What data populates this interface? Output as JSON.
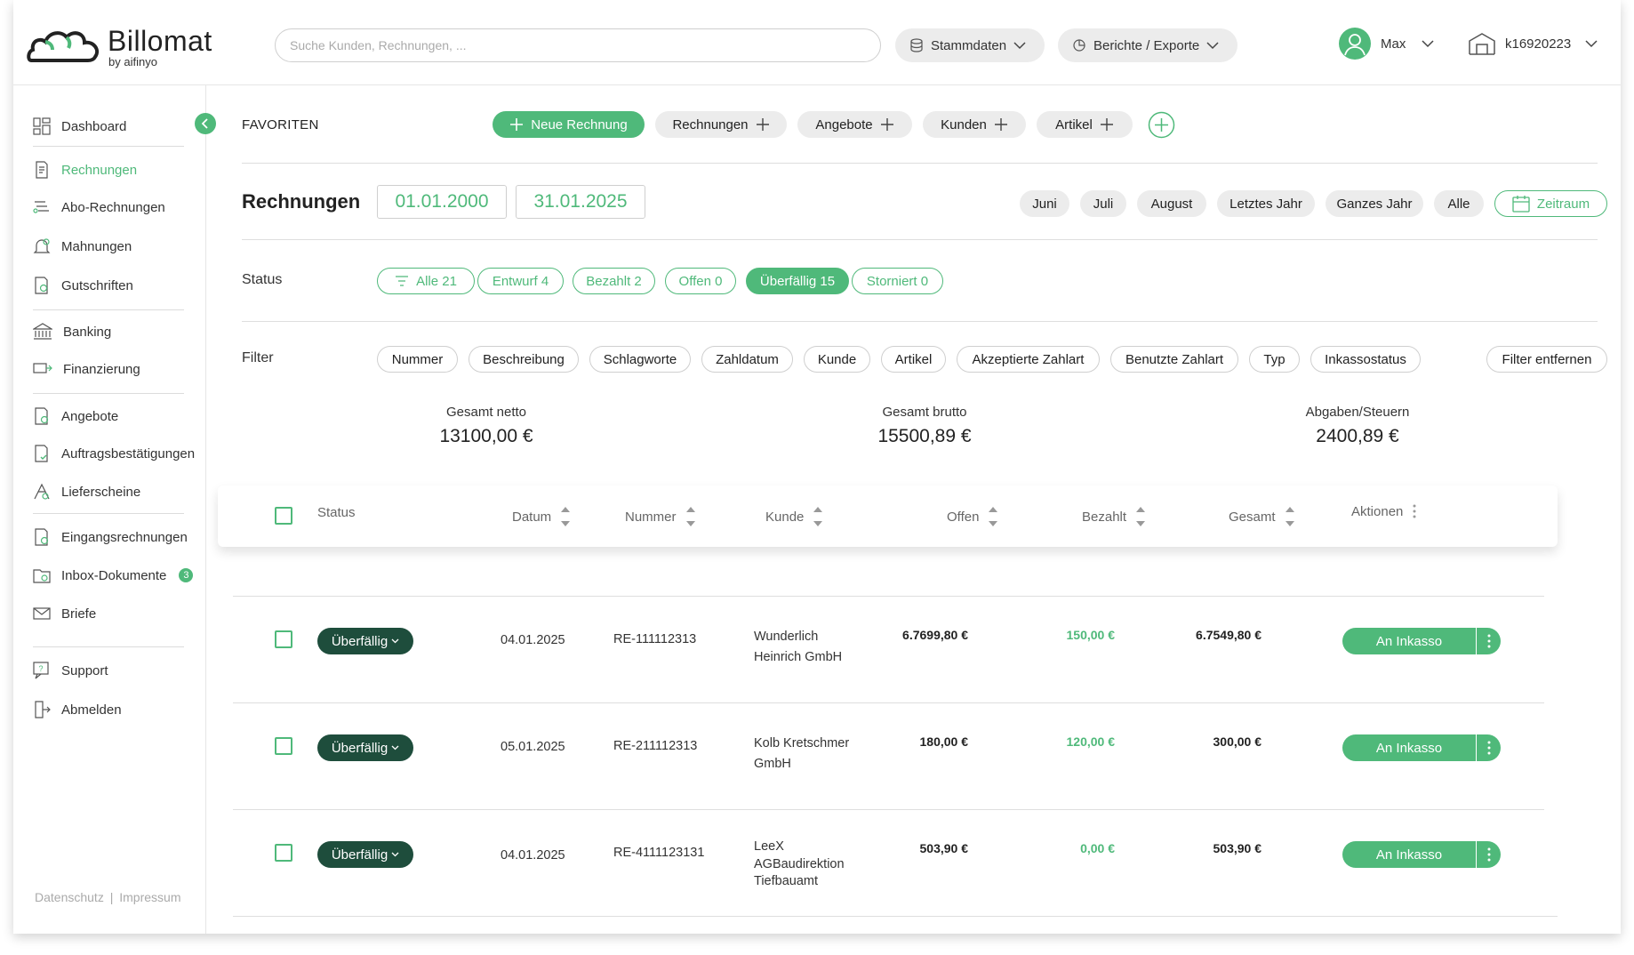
{
  "header": {
    "logo": {
      "brand": "Billomat",
      "sub": "by aifinyo"
    },
    "search": {
      "placeholder": "Suche Kunden, Rechnungen, ..."
    },
    "menus": [
      {
        "label": "Stammdaten",
        "icon": "database-icon"
      },
      {
        "label": "Berichte / Exporte",
        "icon": "pie-chart-icon"
      }
    ],
    "user": {
      "name": "Max",
      "icon": "user-avatar-icon"
    },
    "account": {
      "id": "k16920223",
      "icon": "building-icon"
    }
  },
  "sidebar": {
    "items": [
      {
        "label": "Dashboard",
        "icon": "dashboard-icon"
      },
      {
        "label": "Rechnungen",
        "icon": "invoice-icon",
        "active": true
      },
      {
        "label": "Abo-Rechnungen",
        "icon": "recurring-invoice-icon"
      },
      {
        "label": "Mahnungen",
        "icon": "reminder-icon"
      },
      {
        "label": "Gutschriften",
        "icon": "credit-note-icon"
      },
      {
        "label": "Banking",
        "icon": "bank-icon"
      },
      {
        "label": "Finanzierung",
        "icon": "financing-icon"
      },
      {
        "label": "Angebote",
        "icon": "offer-icon"
      },
      {
        "label": "Auftragsbestätigungen",
        "icon": "order-confirmation-icon"
      },
      {
        "label": "Lieferscheine",
        "icon": "delivery-note-icon"
      },
      {
        "label": "Eingangsrechnungen",
        "icon": "incoming-invoice-icon"
      },
      {
        "label": "Inbox-Dokumente",
        "icon": "inbox-icon",
        "badge": "3"
      },
      {
        "label": "Briefe",
        "icon": "letter-icon"
      },
      {
        "label": "Support",
        "icon": "support-icon"
      },
      {
        "label": "Abmelden",
        "icon": "logout-icon"
      }
    ],
    "footer": {
      "privacy": "Datenschutz",
      "separator": "|",
      "imprint": "Impressum"
    }
  },
  "favorites": {
    "label": "FAVORITEN",
    "new_invoice": "Neue Rechnung",
    "items": [
      "Rechnungen",
      "Angebote",
      "Kunden",
      "Artikel"
    ]
  },
  "page": {
    "title": "Rechnungen",
    "date_from": "01.01.2000",
    "date_to": "31.01.2025",
    "quick_ranges": [
      "Juni",
      "Juli",
      "August",
      "Letztes Jahr",
      "Ganzes Jahr",
      "Alle"
    ],
    "period_button": "Zeitraum"
  },
  "status": {
    "label": "Status",
    "filters": [
      {
        "label": "Alle 21",
        "selected": false
      },
      {
        "label": "Entwurf 4",
        "selected": false
      },
      {
        "label": "Bezahlt 2",
        "selected": false
      },
      {
        "label": "Offen 0",
        "selected": false
      },
      {
        "label": "Überfällig 15",
        "selected": true
      },
      {
        "label": "Storniert 0",
        "selected": false
      }
    ]
  },
  "filter": {
    "label": "Filter",
    "chips": [
      "Nummer",
      "Beschreibung",
      "Schlagworte",
      "Zahldatum",
      "Kunde",
      "Artikel",
      "Akzeptierte Zahlart",
      "Benutzte Zahlart",
      "Typ",
      "Inkassostatus"
    ],
    "remove": "Filter entfernen"
  },
  "summary": [
    {
      "label": "Gesamt netto",
      "value": "13100,00 €"
    },
    {
      "label": "Gesamt brutto",
      "value": "15500,89 €"
    },
    {
      "label": "Abgaben/Steuern",
      "value": "2400,89 €"
    }
  ],
  "table": {
    "columns": {
      "status": "Status",
      "date": "Datum",
      "number": "Nummer",
      "customer": "Kunde",
      "open": "Offen",
      "paid": "Bezahlt",
      "total": "Gesamt",
      "actions": "Aktionen"
    },
    "rows": [
      {
        "status": "Überfällig",
        "date": "04.01.2025",
        "number": "RE-111112313",
        "customer_lines": [
          "Wunderlich",
          "Heinrich GmbH"
        ],
        "open": "6.7699,80 €",
        "paid": "150,00 €",
        "total": "6.7549,80 €",
        "action": "An Inkasso"
      },
      {
        "status": "Überfällig",
        "date": "05.01.2025",
        "number": "RE-211112313",
        "customer_lines": [
          "Kolb Kretschmer",
          "GmbH"
        ],
        "open": "180,00 €",
        "paid": "120,00 €",
        "total": "300,00 €",
        "action": "An Inkasso"
      },
      {
        "status": "Überfällig",
        "date": "04.01.2025",
        "number": "RE-4111123131",
        "customer_lines": [
          "LeeX",
          "AGBaudirektion",
          "Tiefbauamt"
        ],
        "open": "503,90 €",
        "paid": "0,00 €",
        "total": "503,90 €",
        "action": "An Inkasso"
      }
    ]
  },
  "colors": {
    "accent": "#4fb97a",
    "status_dark": "#1e4d3c",
    "pill_grey": "#ececec"
  }
}
